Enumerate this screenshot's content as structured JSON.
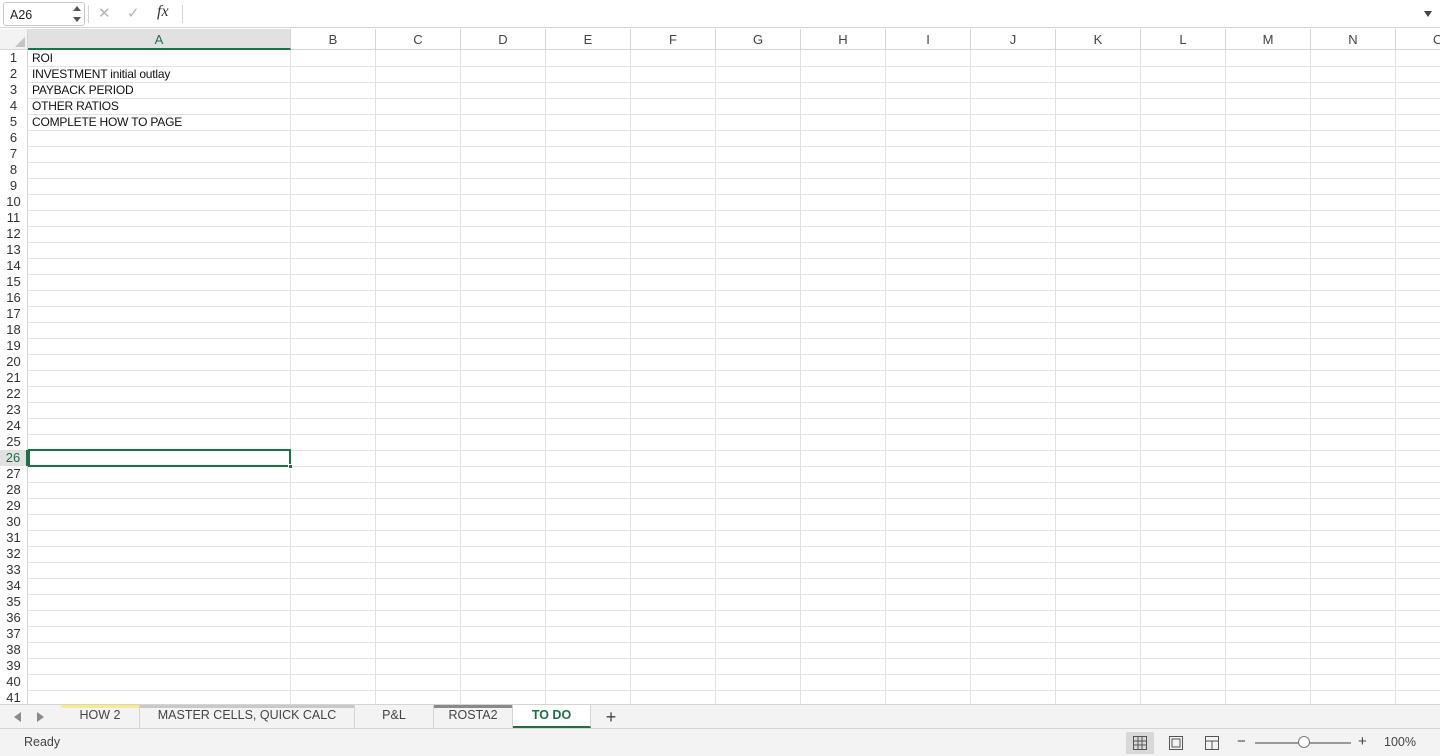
{
  "formula_bar": {
    "name_box": "A26",
    "cancel_icon": "✕",
    "enter_icon": "✓",
    "fx_label": "fx",
    "formula": ""
  },
  "columns": [
    "A",
    "B",
    "C",
    "D",
    "E",
    "F",
    "G",
    "H",
    "I",
    "J",
    "K",
    "L",
    "M",
    "N",
    "O"
  ],
  "selected_column": "A",
  "rows": [
    "1",
    "2",
    "3",
    "4",
    "5",
    "6",
    "7",
    "8",
    "9",
    "10",
    "11",
    "12",
    "13",
    "14",
    "15",
    "16",
    "17",
    "18",
    "19",
    "20",
    "21",
    "22",
    "23",
    "24",
    "25",
    "26",
    "27",
    "28",
    "29",
    "30",
    "31",
    "32",
    "33",
    "34",
    "35",
    "36",
    "37",
    "38",
    "39",
    "40",
    "41"
  ],
  "selected_row": "26",
  "cells": {
    "A1": "ROI",
    "A2": "INVESTMENT initial outlay",
    "A3": "PAYBACK PERIOD",
    "A4": "OTHER RATIOS",
    "A5": "COMPLETE HOW TO PAGE"
  },
  "sheet_tabs": [
    {
      "label": "HOW 2",
      "color": "#f4ee8a",
      "active": false
    },
    {
      "label": "MASTER CELLS, QUICK CALC",
      "color": "#c9c9c9",
      "active": false
    },
    {
      "label": "P&L",
      "color": "",
      "active": false
    },
    {
      "label": "ROSTA2",
      "color": "#8a8a8a",
      "active": false
    },
    {
      "label": "TO DO",
      "color": "",
      "active": true
    }
  ],
  "add_sheet_label": "+",
  "status": {
    "text": "Ready",
    "zoom": "100%",
    "zoom_minus": "−",
    "zoom_plus": "+"
  },
  "colors": {
    "accent": "#1e7145",
    "gridline": "#e2e2e2",
    "header_bg": "#f3f3f3"
  }
}
